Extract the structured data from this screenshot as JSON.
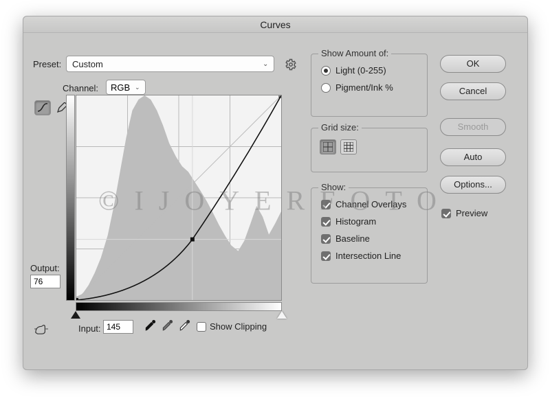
{
  "window": {
    "title": "Curves"
  },
  "preset": {
    "label": "Preset:",
    "value": "Custom"
  },
  "channel": {
    "label": "Channel:",
    "value": "RGB"
  },
  "output": {
    "label": "Output:",
    "value": "76"
  },
  "input": {
    "label": "Input:",
    "value": "145"
  },
  "show_clipping": {
    "label": "Show Clipping",
    "checked": false
  },
  "show_amount": {
    "title": "Show Amount of:",
    "light_label": "Light  (0-255)",
    "pigment_label": "Pigment/Ink %",
    "selected": "light"
  },
  "grid": {
    "title": "Grid size:",
    "selected": "small"
  },
  "show": {
    "title": "Show:",
    "channel_overlays": {
      "label": "Channel Overlays",
      "checked": true
    },
    "histogram": {
      "label": "Histogram",
      "checked": true
    },
    "baseline": {
      "label": "Baseline",
      "checked": true
    },
    "intersection_line": {
      "label": "Intersection Line",
      "checked": true
    }
  },
  "buttons": {
    "ok": "OK",
    "cancel": "Cancel",
    "smooth": "Smooth",
    "auto": "Auto",
    "options": "Options..."
  },
  "preview": {
    "label": "Preview",
    "checked": true
  },
  "watermark": "©IJOYERFOTO",
  "chart_data": {
    "type": "line",
    "title": "Curves",
    "xlabel": "Input",
    "ylabel": "Output",
    "xlim": [
      0,
      255
    ],
    "ylim": [
      0,
      255
    ],
    "series": [
      {
        "name": "curve",
        "x": [
          0,
          145,
          255
        ],
        "y": [
          0,
          76,
          255
        ]
      }
    ],
    "histogram": {
      "bins": [
        0,
        8,
        16,
        24,
        32,
        40,
        48,
        56,
        64,
        72,
        80,
        88,
        96,
        104,
        112,
        120,
        128,
        136,
        144,
        152,
        160,
        168,
        176,
        184,
        192,
        200,
        208,
        216,
        224,
        232,
        240,
        248,
        255
      ],
      "values": [
        0.02,
        0.05,
        0.1,
        0.18,
        0.28,
        0.42,
        0.58,
        0.75,
        0.9,
        0.97,
        1.0,
        0.98,
        0.93,
        0.86,
        0.78,
        0.72,
        0.68,
        0.65,
        0.6,
        0.55,
        0.49,
        0.42,
        0.36,
        0.3,
        0.25,
        0.22,
        0.28,
        0.38,
        0.48,
        0.42,
        0.3,
        0.38,
        0.45
      ]
    }
  }
}
